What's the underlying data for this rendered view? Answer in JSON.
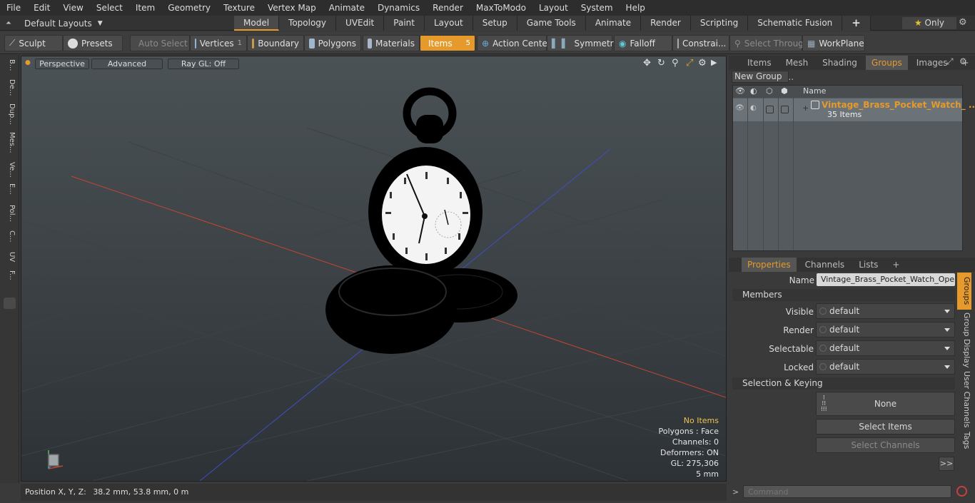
{
  "menu": [
    "File",
    "Edit",
    "View",
    "Select",
    "Item",
    "Geometry",
    "Texture",
    "Vertex Map",
    "Animate",
    "Dynamics",
    "Render",
    "MaxToModo",
    "Layout",
    "System",
    "Help"
  ],
  "modebar": {
    "layouts": "Default Layouts",
    "tabs": [
      "Model",
      "Topology",
      "UVEdit",
      "Paint",
      "Layout",
      "Setup",
      "Game Tools",
      "Animate",
      "Render",
      "Scripting",
      "Schematic Fusion"
    ],
    "plus": "+",
    "only": "Only"
  },
  "toolbar": {
    "sculpt": "Sculpt",
    "presets": "Presets",
    "auto_select": "Auto Select",
    "vertices": "Vertices",
    "vertices_count": "1",
    "boundary": "Boundary",
    "polygons": "Polygons",
    "materials": "Materials",
    "items": "Items",
    "items_count": "5",
    "action_center": "Action Center",
    "symmetry": "Symmetry",
    "falloff": "Falloff",
    "constraints": "Constrai...",
    "select_through": "Select Through",
    "workplane": "WorkPlane"
  },
  "leftstrip": [
    "B...",
    "De...",
    "Dup...",
    "Mes...",
    "Ve...",
    "E...",
    "Pol...",
    "C...",
    "UV",
    "F..."
  ],
  "viewport": {
    "perspective": "Perspective",
    "advanced": "Advanced",
    "raygl": "Ray GL: Off",
    "no_items": "No Items",
    "polygons": "Polygons : Face",
    "channels": "Channels: 0",
    "deformers": "Deformers: ON",
    "gl": "GL: 275,306",
    "scale": "5 mm"
  },
  "status": {
    "position_label": "Position X, Y, Z:",
    "position_value": "38.2 mm, 53.8 mm, 0 m"
  },
  "groups_panel": {
    "tabs": [
      "Items",
      "Mesh ...",
      "Shading",
      "Groups",
      "Images"
    ],
    "active_tab": "Groups",
    "new_group": "New Group",
    "col_name": "Name",
    "group_name": "Vintage_Brass_Pocket_Watch_ ...",
    "group_count": "35 Items"
  },
  "properties_panel": {
    "tabs": [
      "Properties",
      "Channels",
      "Lists"
    ],
    "name_label": "Name",
    "name_value": "Vintage_Brass_Pocket_Watch_Open (",
    "members": "Members",
    "visible_label": "Visible",
    "visible_value": "default",
    "render_label": "Render",
    "render_value": "default",
    "selectable_label": "Selectable",
    "selectable_value": "default",
    "locked_label": "Locked",
    "locked_value": "default",
    "selection_keying": "Selection & Keying",
    "none": "None",
    "select_items": "Select Items",
    "select_channels": "Select Channels",
    "more": ">>",
    "vtabs": [
      "Groups",
      "Group Display",
      "User Channels",
      "Tags"
    ]
  },
  "command": {
    "placeholder": "Command"
  },
  "colors": {
    "accent": "#e59a2b",
    "x_axis": "#c8452f",
    "z_axis": "#3f4fc0"
  }
}
